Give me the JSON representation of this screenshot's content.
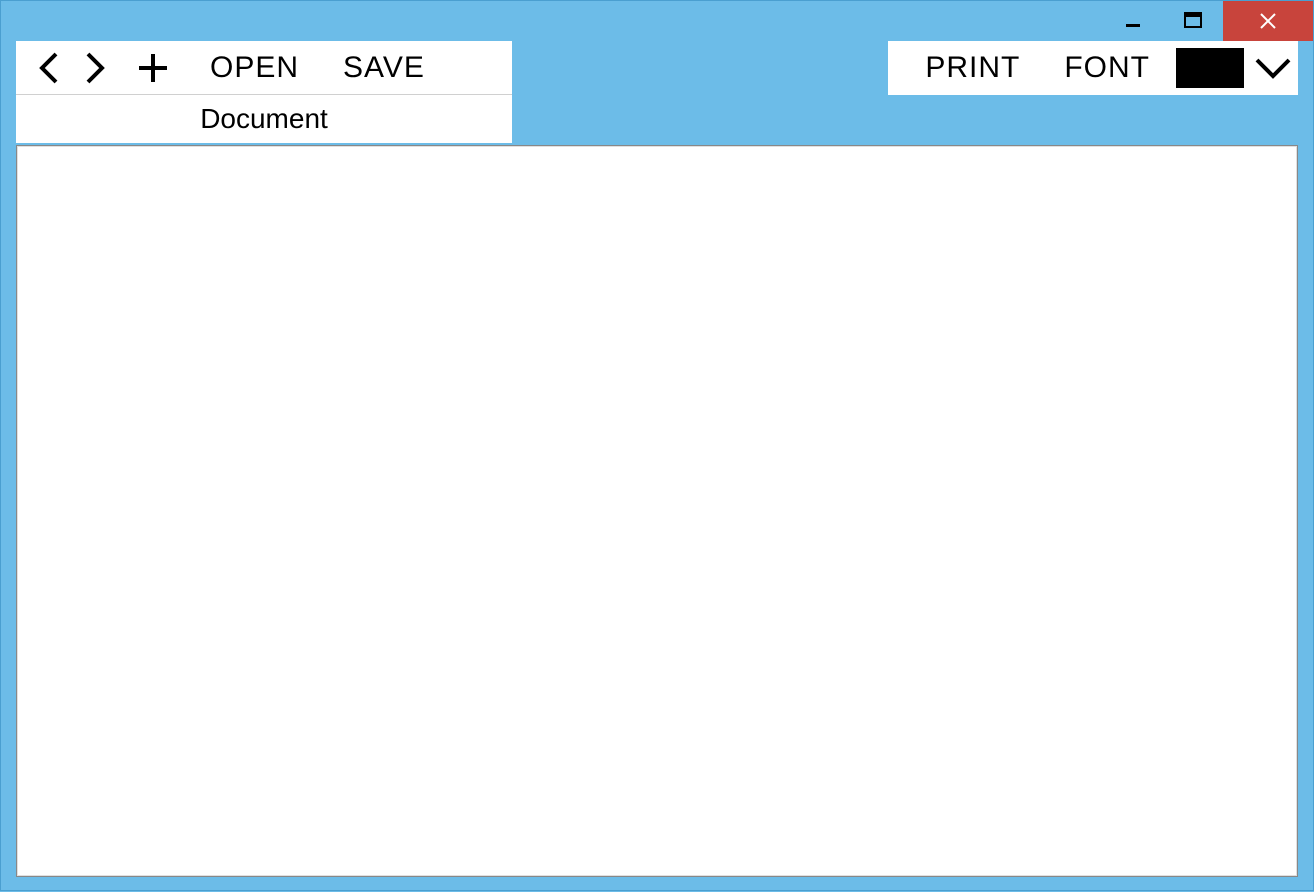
{
  "toolbar": {
    "open_label": "OPEN",
    "save_label": "SAVE",
    "print_label": "PRINT",
    "font_label": "FONT",
    "color_swatch": "#000000"
  },
  "tabs": [
    {
      "label": "Document"
    }
  ],
  "editor": {
    "content": ""
  }
}
